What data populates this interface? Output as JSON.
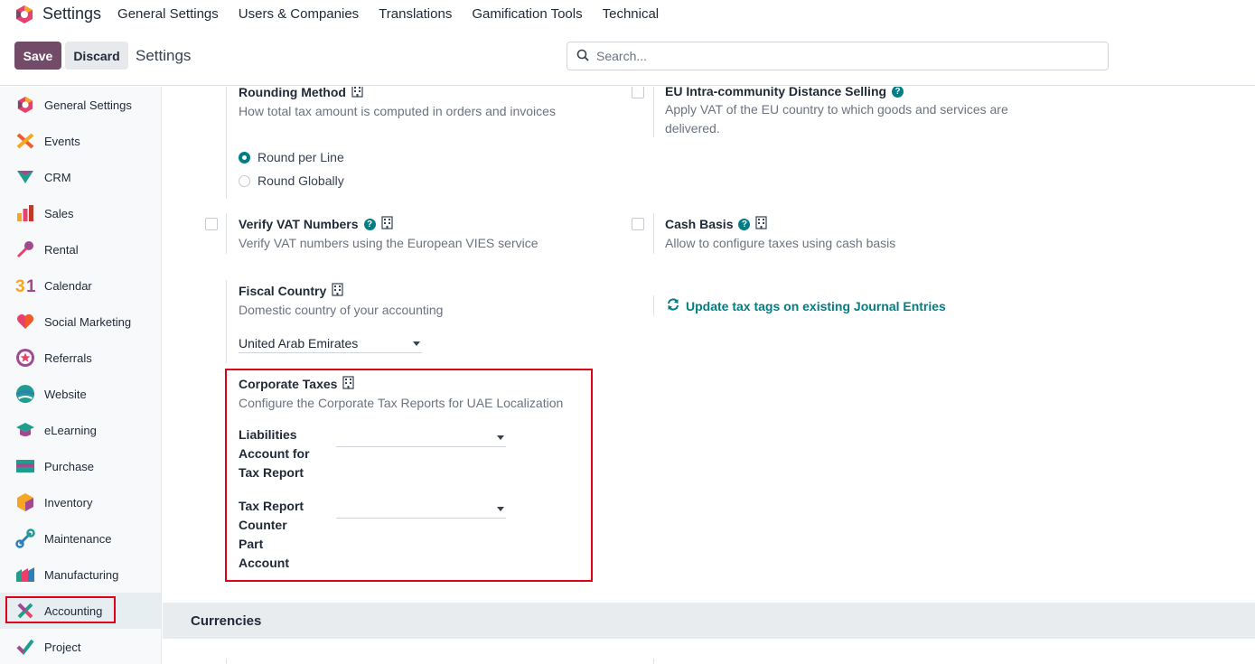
{
  "app": {
    "title": "Settings"
  },
  "menu": [
    "General Settings",
    "Users & Companies",
    "Translations",
    "Gamification Tools",
    "Technical"
  ],
  "control": {
    "save": "Save",
    "discard": "Discard",
    "breadcrumb": "Settings",
    "search_placeholder": "Search..."
  },
  "sidebar": {
    "active": "Accounting",
    "items": [
      {
        "label": "General Settings",
        "icon": "odoo-logo-icon"
      },
      {
        "label": "Events",
        "icon": "events-icon"
      },
      {
        "label": "CRM",
        "icon": "crm-icon"
      },
      {
        "label": "Sales",
        "icon": "sales-icon"
      },
      {
        "label": "Rental",
        "icon": "rental-key-icon"
      },
      {
        "label": "Calendar",
        "icon": "calendar-icon"
      },
      {
        "label": "Social Marketing",
        "icon": "heart-icon"
      },
      {
        "label": "Referrals",
        "icon": "referrals-icon"
      },
      {
        "label": "Website",
        "icon": "website-icon"
      },
      {
        "label": "eLearning",
        "icon": "graduation-cap-icon"
      },
      {
        "label": "Purchase",
        "icon": "purchase-card-icon"
      },
      {
        "label": "Inventory",
        "icon": "inventory-box-icon"
      },
      {
        "label": "Maintenance",
        "icon": "maintenance-icon"
      },
      {
        "label": "Manufacturing",
        "icon": "manufacturing-icon"
      },
      {
        "label": "Accounting",
        "icon": "accounting-icon"
      },
      {
        "label": "Project",
        "icon": "project-check-icon"
      }
    ]
  },
  "settings": {
    "rounding": {
      "title": "Rounding Method",
      "desc": "How total tax amount is computed in orders and invoices",
      "options": [
        "Round per Line",
        "Round Globally"
      ],
      "selected": "Round per Line"
    },
    "eu_distance": {
      "title": "EU Intra-community Distance Selling",
      "desc": "Apply VAT of the EU country to which goods and services are delivered."
    },
    "verify_vat": {
      "title": "Verify VAT Numbers",
      "desc": "Verify VAT numbers using the European VIES service"
    },
    "cash_basis": {
      "title": "Cash Basis",
      "desc": "Allow to configure taxes using cash basis"
    },
    "fiscal_country": {
      "title": "Fiscal Country",
      "desc": "Domestic country of your accounting",
      "value": "United Arab Emirates"
    },
    "update_tags": {
      "label": "Update tax tags on existing Journal Entries"
    },
    "corporate_taxes": {
      "title": "Corporate Taxes",
      "desc": "Configure the Corporate Tax Reports for UAE Localization",
      "liabilities_label": "Liabilities Account for Tax Report",
      "counterpart_label": "Tax Report Counter Part Account"
    }
  },
  "sections": {
    "currencies": "Currencies"
  },
  "colors": {
    "brand": "#714b67",
    "accent": "#017e84",
    "highlight": "#e0001a"
  }
}
